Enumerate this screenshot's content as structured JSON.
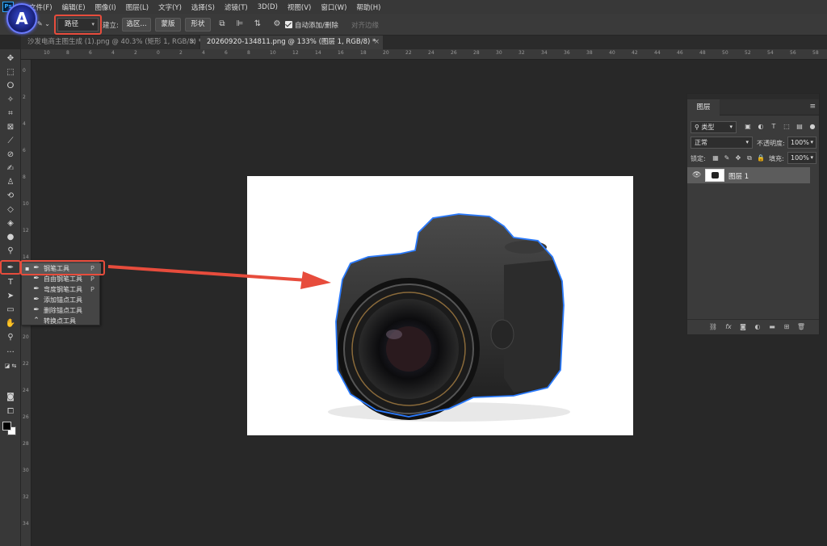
{
  "menubar": {
    "logo": "Ps",
    "items": [
      "文件(F)",
      "编辑(E)",
      "图像(I)",
      "图层(L)",
      "文字(Y)",
      "选择(S)",
      "滤镜(T)",
      "3D(D)",
      "视图(V)",
      "窗口(W)",
      "帮助(H)"
    ]
  },
  "options": {
    "brand_letter": "A",
    "mode_value": "路径",
    "make_label": "建立:",
    "selection_btn": "选区...",
    "mask_btn": "蒙版",
    "shape_btn": "形状",
    "auto_add_label": "自动添加/删除",
    "align_edges_label": "对齐边缘"
  },
  "tabs": [
    {
      "label": "沙发电商主图生成 (1).png @ 40.3% (矩形 1, RGB/8) *"
    },
    {
      "label": "20260920-134811.png @ 133% (图层 1, RGB/8) *"
    }
  ],
  "ruler": {
    "top_labels": [
      "10",
      "8",
      "6",
      "4",
      "2",
      "0",
      "2",
      "4",
      "6",
      "8",
      "10",
      "12",
      "14",
      "16",
      "18",
      "20",
      "22",
      "24",
      "26",
      "28",
      "30",
      "32",
      "34",
      "36",
      "38",
      "40",
      "42",
      "44",
      "46",
      "48",
      "50",
      "52",
      "54",
      "56",
      "58"
    ],
    "left_labels": [
      "0",
      "2",
      "4",
      "6",
      "8",
      "10",
      "12",
      "14",
      "16",
      "18",
      "20",
      "22",
      "24",
      "26",
      "28",
      "30",
      "32",
      "34"
    ]
  },
  "flyout": {
    "items": [
      {
        "label": "钢笔工具",
        "key": "P",
        "icon": "pen-icon",
        "selected": true
      },
      {
        "label": "自由钢笔工具",
        "key": "P",
        "icon": "freeform-pen-icon",
        "selected": false
      },
      {
        "label": "弯度钢笔工具",
        "key": "P",
        "icon": "curvature-pen-icon",
        "selected": false
      },
      {
        "label": "添加锚点工具",
        "key": "",
        "icon": "add-anchor-icon",
        "selected": false
      },
      {
        "label": "删除锚点工具",
        "key": "",
        "icon": "delete-anchor-icon",
        "selected": false
      },
      {
        "label": "转换点工具",
        "key": "",
        "icon": "convert-point-icon",
        "selected": false
      }
    ]
  },
  "layers": {
    "tab_label": "图层",
    "filter_label": "类型",
    "blend_mode": "正常",
    "opacity_label": "不透明度:",
    "opacity_value": "100%",
    "lock_label": "锁定:",
    "fill_label": "填充:",
    "fill_value": "100%",
    "layer_name": "图层 1",
    "fx_label": "fx"
  },
  "colors": {
    "accent_red": "#e74c3c",
    "path_blue": "#2b7bff",
    "canvas_bg": "#ffffff",
    "workspace_bg": "#282828"
  }
}
